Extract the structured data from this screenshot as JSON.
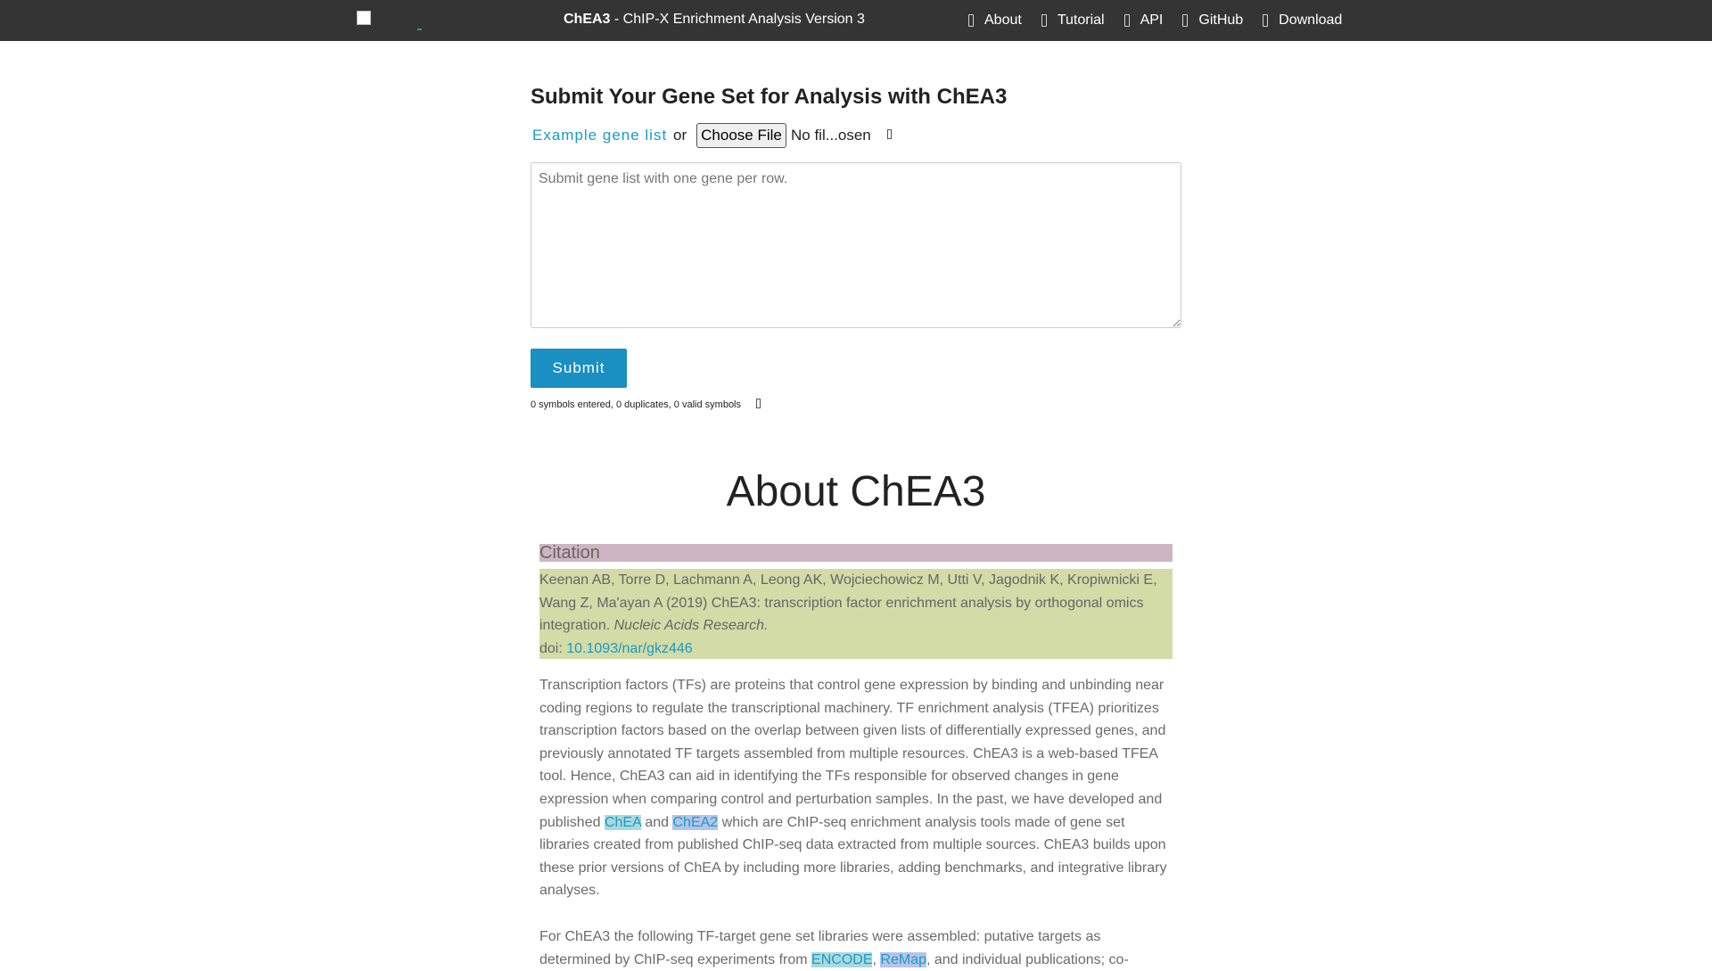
{
  "navbar": {
    "brand_bold": "ChEA3",
    "brand_rest": " - ChIP-X Enrichment Analysis Version 3",
    "links": [
      {
        "label": "About",
        "icon": "info-icon"
      },
      {
        "label": "Tutorial",
        "icon": "book-icon"
      },
      {
        "label": "API",
        "icon": "code-icon"
      },
      {
        "label": "GitHub",
        "icon": "github-icon"
      },
      {
        "label": "Download",
        "icon": "download-icon"
      }
    ]
  },
  "form": {
    "title": "Submit Your Gene Set for Analysis with ChEA3",
    "example_link": "Example gene list",
    "or_text": "or",
    "choose_file_label": "Choose File",
    "file_status": "No fil...osen",
    "textarea_placeholder": "Submit gene list with one gene per row.",
    "submit_label": "Submit",
    "symbol_counts": "0 symbols entered, 0 duplicates, 0 valid symbols"
  },
  "about": {
    "title": "About ChEA3",
    "citation_header": "Citation",
    "citation_text": "Keenan AB, Torre D, Lachmann A, Leong AK, Wojciechowicz M, Utti V, Jagodnik K, Kropiwnicki E, Wang Z, Ma'ayan A (2019) ChEA3: transcription factor enrichment analysis by orthogonal omics integration.",
    "citation_journal": "Nucleic Acids Research.",
    "doi_label": "doi:",
    "doi_link": "10.1093/nar/gkz446",
    "para1_a": "Transcription factors (TFs) are proteins that control gene expression by binding and unbinding near coding regions to regulate the transcriptional machinery. TF enrichment analysis (TFEA) prioritizes transcription factors based on the overlap between given lists of differentially expressed genes, and previously annotated TF targets assembled from multiple resources. ChEA3 is a web-based TFEA tool. Hence, ChEA3 can aid in identifying the TFs responsible for observed changes in gene expression when comparing control and perturbation samples. In the past, we have developed and published",
    "para1_link1": "ChEA",
    "para1_and": "and",
    "para1_link2": "ChEA2",
    "para1_b": "which are ChIP-seq enrichment analysis tools made of gene set libraries created from published ChIP-seq data extracted from multiple sources. ChEA3 builds upon these prior versions of ChEA by including more libraries, adding benchmarks, and integrative library analyses.",
    "para2_a": "For ChEA3 the following TF-target gene set libraries were assembled: putative targets as determined by ChIP-seq experiments from",
    "para2_link1": "ENCODE",
    "para2_comma": ",",
    "para2_link2": "ReMap",
    "para2_b": ", and individual publications; co-"
  }
}
